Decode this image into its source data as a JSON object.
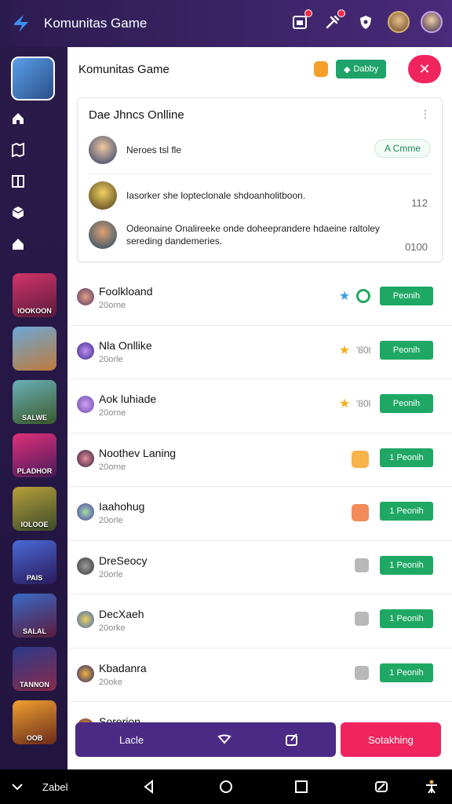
{
  "topbar": {
    "title": "Komunitas Game"
  },
  "main": {
    "title": "Komunitas Game",
    "header_button": "Dabby",
    "close_symbol": "✕"
  },
  "card": {
    "title": "Dae Jhncs Onlline",
    "more": "⋮",
    "rows": [
      {
        "text": "Neroes tsl fle"
      },
      {
        "text": "Iasorker she lopteclonale shdoanholitboon."
      },
      {
        "text": "Odeonaine Onalireeke onde doheeprandere hdaeine raltoley sereding dandemeries."
      }
    ],
    "button": "A Cmme",
    "numbers": [
      "112",
      "0100"
    ]
  },
  "games": [
    {
      "name": "Foolkloand",
      "sub": "20orne",
      "extra": "",
      "button": "Peonih"
    },
    {
      "name": "Nla Onllike",
      "sub": "20orle",
      "extra": "'80l",
      "button": "Peonih"
    },
    {
      "name": "Aok luhiade",
      "sub": "20orne",
      "extra": "'80l",
      "button": "Peonih"
    },
    {
      "name": "Noothev Laning",
      "sub": "20orne",
      "extra": "",
      "button": "1 Peonih"
    },
    {
      "name": "Iaahohug",
      "sub": "20orle",
      "extra": "",
      "button": "1 Peonih"
    },
    {
      "name": "DreSeocy",
      "sub": "20orle",
      "extra": "",
      "button": "1 Peonih"
    },
    {
      "name": "DecXaeh",
      "sub": "20orke",
      "extra": "",
      "button": "1 Peonih"
    },
    {
      "name": "Kbadanra",
      "sub": "20oke",
      "extra": "",
      "button": "1 Peonih"
    },
    {
      "name": "Sorerion",
      "sub": "",
      "extra": "",
      "button": ""
    }
  ],
  "side_games": [
    {
      "label": "IOOKOON"
    },
    {
      "label": ""
    },
    {
      "label": "SALWE"
    },
    {
      "label": "PLADHOR"
    },
    {
      "label": "IOLOOE"
    },
    {
      "label": "PAIS"
    },
    {
      "label": "SALAL"
    },
    {
      "label": "TANNON"
    },
    {
      "label": "OOB"
    }
  ],
  "actionbar": {
    "label": "Lacle",
    "primary": "Sotakhing"
  },
  "sysnav": {
    "label": "Zabel"
  }
}
